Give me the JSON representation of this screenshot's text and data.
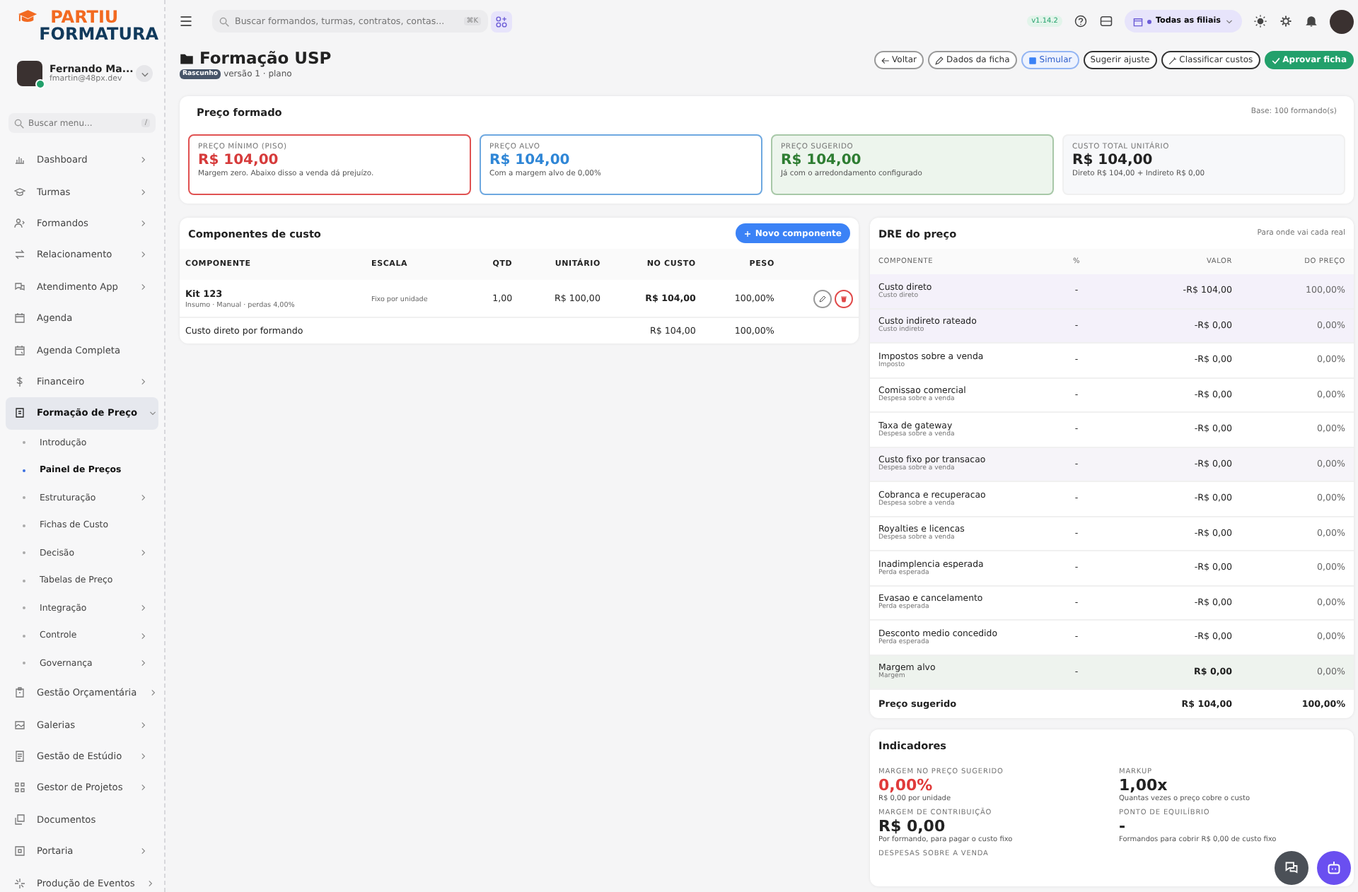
{
  "brand": {
    "line_1": "PARTIU",
    "line_2": "FORMATURA"
  },
  "user": {
    "name": "Fernando Ma...",
    "email": "fmartin@48px.dev",
    "online": true
  },
  "sidebar": {
    "search_placeholder": "Buscar menu...",
    "search_shortcut": "/",
    "items": [
      {
        "label": "Dashboard",
        "has_submenu": true,
        "expanded": false,
        "selected": false
      },
      {
        "label": "Turmas",
        "has_submenu": true,
        "expanded": false,
        "selected": false
      },
      {
        "label": "Formandos",
        "has_submenu": true,
        "expanded": false,
        "selected": false
      },
      {
        "label": "Relacionamento",
        "has_submenu": true,
        "expanded": false,
        "selected": false
      },
      {
        "label": "Atendimento App",
        "has_submenu": true,
        "expanded": false,
        "selected": false
      },
      {
        "label": "Agenda",
        "has_submenu": false,
        "selected": false
      },
      {
        "label": "Agenda Completa",
        "has_submenu": false,
        "selected": false
      },
      {
        "label": "Financeiro",
        "has_submenu": true,
        "expanded": false,
        "selected": false
      },
      {
        "label": "Formação de Preço",
        "has_submenu": true,
        "expanded": true,
        "selected": true,
        "children": [
          {
            "label": "Introdução",
            "has_submenu": false,
            "selected": false
          },
          {
            "label": "Painel de Preços",
            "has_submenu": false,
            "selected": true
          },
          {
            "label": "Estruturação",
            "has_submenu": true,
            "selected": false
          },
          {
            "label": "Fichas de Custo",
            "has_submenu": false,
            "selected": false
          },
          {
            "label": "Decisão",
            "has_submenu": true,
            "selected": false
          },
          {
            "label": "Tabelas de Preço",
            "has_submenu": false,
            "selected": false
          },
          {
            "label": "Integração",
            "has_submenu": true,
            "selected": false
          },
          {
            "label": "Controle",
            "has_submenu": true,
            "selected": false
          },
          {
            "label": "Governança",
            "has_submenu": true,
            "selected": false
          }
        ]
      },
      {
        "label": "Gestão Orçamentária",
        "has_submenu": true,
        "expanded": false,
        "selected": false
      },
      {
        "label": "Galerias",
        "has_submenu": true,
        "expanded": false,
        "selected": false
      },
      {
        "label": "Gestão de Estúdio",
        "has_submenu": true,
        "expanded": false,
        "selected": false
      },
      {
        "label": "Gestor de Projetos",
        "has_submenu": true,
        "expanded": false,
        "selected": false
      },
      {
        "label": "Documentos",
        "has_submenu": false,
        "selected": false
      },
      {
        "label": "Portaria",
        "has_submenu": true,
        "expanded": false,
        "selected": false
      },
      {
        "label": "Produção de Eventos",
        "has_submenu": true,
        "expanded": false,
        "selected": false
      }
    ]
  },
  "topbar": {
    "search_placeholder": "Buscar formandos, turmas, contratos, contas...",
    "search_shortcut": "⌘K",
    "version": "v1.14.2",
    "branch_selector": "Todas as filiais"
  },
  "page": {
    "title": "Formação USP",
    "status_badge": "Rascunho",
    "subtitle": "versão 1 · plano",
    "actions": [
      {
        "label": "Voltar",
        "kind": "back"
      },
      {
        "label": "Dados da ficha",
        "kind": "edit"
      },
      {
        "label": "Simular",
        "kind": "simulate"
      },
      {
        "label": "Sugerir ajuste",
        "kind": "plain"
      },
      {
        "label": "Classificar custos",
        "kind": "classify"
      },
      {
        "label": "Aprovar ficha",
        "kind": "approve"
      }
    ]
  },
  "price_summary": {
    "title": "Preço formado",
    "base": "Base: 100 formando(s)",
    "cards": [
      {
        "label": "PREÇO MÍNIMO (PISO)",
        "value": "R$ 104,00",
        "note": "Margem zero. Abaixo disso a venda dá prejuízo.",
        "kind": "floor"
      },
      {
        "label": "PREÇO ALVO",
        "value": "R$ 104,00",
        "note": "Com a margem alvo de 0,00%",
        "kind": "target"
      },
      {
        "label": "PREÇO SUGERIDO",
        "value": "R$ 104,00",
        "note": "Já com o arredondamento configurado",
        "kind": "suggested"
      },
      {
        "label": "CUSTO TOTAL UNITÁRIO",
        "value": "R$ 104,00",
        "note": "Direto R$ 104,00 + Indireto R$ 0,00",
        "kind": "total"
      }
    ]
  },
  "components": {
    "title": "Componentes de custo",
    "add_button": "Novo componente",
    "columns": [
      "COMPONENTE",
      "ESCALA",
      "QTD",
      "UNITÁRIO",
      "NO CUSTO",
      "PESO"
    ],
    "rows": [
      {
        "name": "Kit 123",
        "detail": "Insumo · Manual · perdas 4,00%",
        "scale": "Fixo por unidade",
        "qty": "1,00",
        "unit": "R$ 100,00",
        "cost": "R$ 104,00",
        "weight": "100,00%"
      }
    ],
    "footer": {
      "label": "Custo direto por formando",
      "cost": "R$ 104,00",
      "weight": "100,00%"
    }
  },
  "dre": {
    "title": "DRE do preço",
    "hint": "Para onde vai cada real",
    "columns": [
      "COMPONENTE",
      "%",
      "VALOR",
      "DO PREÇO"
    ],
    "rows": [
      {
        "name": "Custo direto",
        "category": "Custo direto",
        "pct": "-",
        "value": "-R$ 104,00",
        "share": "100,00%",
        "kind": "cost"
      },
      {
        "name": "Custo indireto rateado",
        "category": "Custo indireto",
        "pct": "-",
        "value": "-R$ 0,00",
        "share": "0,00%",
        "kind": "cost"
      },
      {
        "name": "Impostos sobre a venda",
        "category": "Imposto",
        "pct": "-",
        "value": "-R$ 0,00",
        "share": "0,00%",
        "kind": "plain"
      },
      {
        "name": "Comissao comercial",
        "category": "Despesa sobre a venda",
        "pct": "-",
        "value": "-R$ 0,00",
        "share": "0,00%",
        "kind": "plain"
      },
      {
        "name": "Taxa de gateway",
        "category": "Despesa sobre a venda",
        "pct": "-",
        "value": "-R$ 0,00",
        "share": "0,00%",
        "kind": "plain"
      },
      {
        "name": "Custo fixo por transacao",
        "category": "Despesa sobre a venda",
        "pct": "-",
        "value": "-R$ 0,00",
        "share": "0,00%",
        "kind": "fixed"
      },
      {
        "name": "Cobranca e recuperacao",
        "category": "Despesa sobre a venda",
        "pct": "-",
        "value": "-R$ 0,00",
        "share": "0,00%",
        "kind": "plain"
      },
      {
        "name": "Royalties e licencas",
        "category": "Despesa sobre a venda",
        "pct": "-",
        "value": "-R$ 0,00",
        "share": "0,00%",
        "kind": "plain"
      },
      {
        "name": "Inadimplencia esperada",
        "category": "Perda esperada",
        "pct": "-",
        "value": "-R$ 0,00",
        "share": "0,00%",
        "kind": "plain"
      },
      {
        "name": "Evasao e cancelamento",
        "category": "Perda esperada",
        "pct": "-",
        "value": "-R$ 0,00",
        "share": "0,00%",
        "kind": "plain"
      },
      {
        "name": "Desconto medio concedido",
        "category": "Perda esperada",
        "pct": "-",
        "value": "-R$ 0,00",
        "share": "0,00%",
        "kind": "plain"
      },
      {
        "name": "Margem alvo",
        "category": "Margem",
        "pct": "-",
        "value": "R$ 0,00",
        "share": "0,00%",
        "kind": "margin"
      }
    ],
    "total": {
      "label": "Preço sugerido",
      "value": "R$ 104,00",
      "share": "100,00%"
    }
  },
  "indicators": {
    "title": "Indicadores",
    "items": [
      {
        "label": "MARGEM NO PREÇO SUGERIDO",
        "value": "0,00%",
        "note": "R$ 0,00 por unidade",
        "alert": true
      },
      {
        "label": "MARKUP",
        "value": "1,00x",
        "note": "Quantas vezes o preço cobre o custo",
        "alert": false
      },
      {
        "label": "MARGEM DE CONTRIBUIÇÃO",
        "value": "R$ 0,00",
        "note": "Por formando, para pagar o custo fixo",
        "alert": false
      },
      {
        "label": "PONTO DE EQUILÍBRIO",
        "value": "-",
        "note": "Formandos para cobrir R$ 0,00 de custo fixo",
        "alert": false
      },
      {
        "label": "DESPESAS SOBRE A VENDA"
      }
    ]
  }
}
